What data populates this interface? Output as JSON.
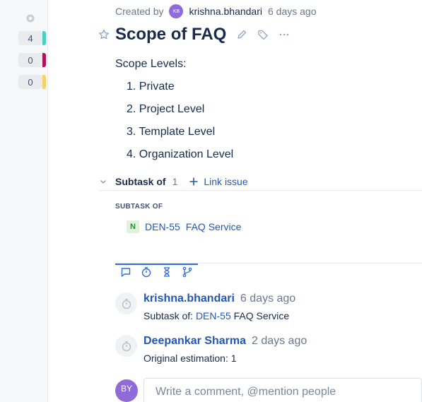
{
  "rail": {
    "badges": [
      {
        "count": "4",
        "color": "#4ecdc4"
      },
      {
        "count": "0",
        "color": "#b0125b"
      },
      {
        "count": "0",
        "color": "#f6d365"
      }
    ]
  },
  "meta": {
    "created_by_label": "Created by",
    "avatar_initials": "KB",
    "author": "krishna.bhandari",
    "time": "6 days ago"
  },
  "issue": {
    "title": "Scope of FAQ"
  },
  "description": {
    "heading": "Scope Levels:",
    "items": [
      "1. Private",
      "2. Project Level",
      "3. Template Level",
      "4. Organization Level"
    ]
  },
  "subtask": {
    "label": "Subtask of",
    "count": "1",
    "link_label": "Link issue",
    "section_heading": "SUBTASK OF",
    "item": {
      "badge": "N",
      "key": "DEN-55",
      "summary": "FAQ Service"
    }
  },
  "activity": [
    {
      "name": "krishna.bhandari",
      "time": "6 days ago",
      "prefix": "Subtask of: ",
      "link": "DEN-55",
      "suffix": " FAQ Service"
    },
    {
      "name": "Deepankar Sharma",
      "time": "2 days ago",
      "prefix": "Original estimation: 1",
      "link": "",
      "suffix": ""
    }
  ],
  "comment": {
    "avatar_initials": "BY",
    "placeholder": "Write a comment, @mention people"
  },
  "colors": {
    "accent": "#2f6ed8",
    "link": "#2456b4",
    "avatar": "#8e6bd8"
  }
}
